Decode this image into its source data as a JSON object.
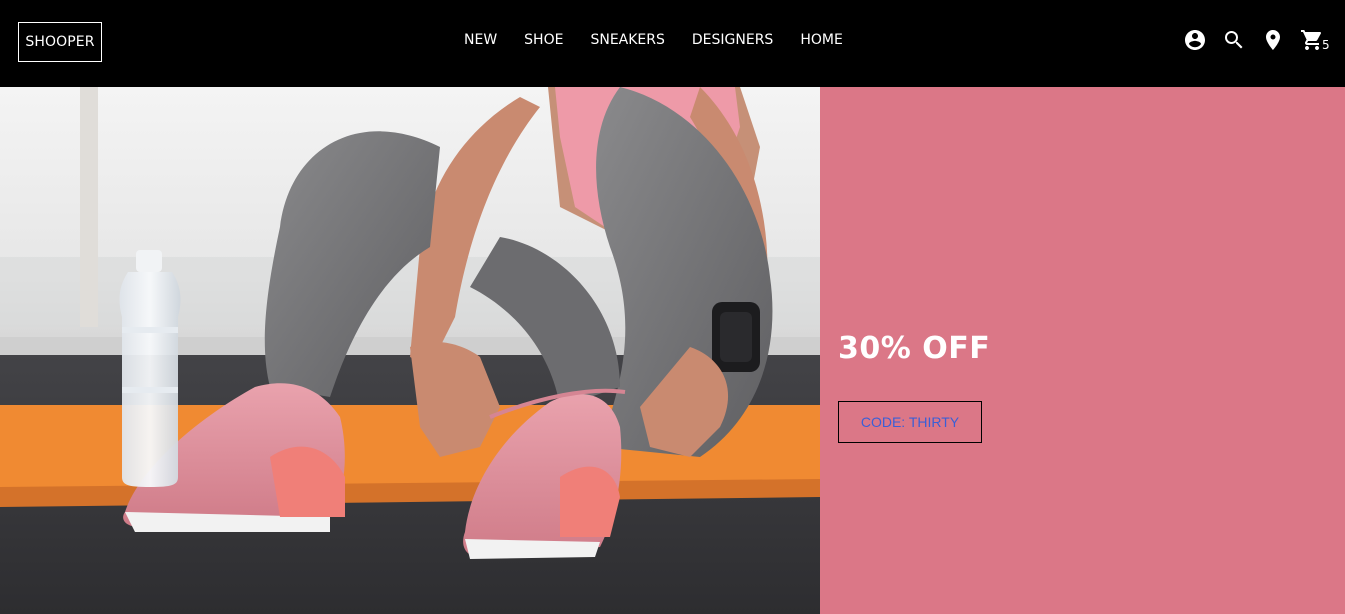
{
  "brand": {
    "logo_text": "SHOOPER"
  },
  "nav": {
    "links": [
      "NEW",
      "SHOE",
      "SNEAKERS",
      "DESIGNERS",
      "HOME"
    ]
  },
  "icons": {
    "account": "account-circle-icon",
    "search": "search-icon",
    "location": "location-pin-icon",
    "cart": "shopping-cart-icon"
  },
  "cart": {
    "count": "5"
  },
  "promo": {
    "title": "30% OFF",
    "code_label": "CODE: THIRTY",
    "background": "#db7787",
    "code_color": "#3b5fd6"
  },
  "hero": {
    "image": "woman-tying-pink-sneakers-illustration"
  }
}
